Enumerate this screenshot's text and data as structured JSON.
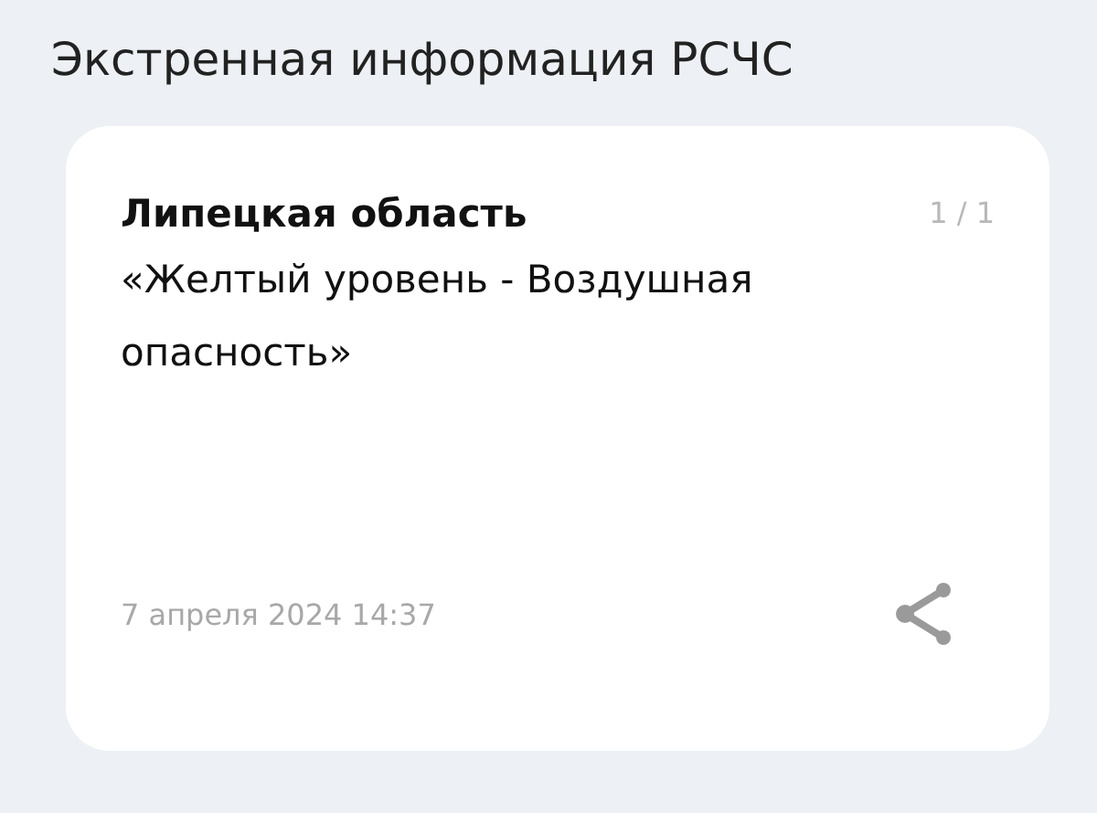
{
  "header": {
    "title": "Экстренная информация РСЧС"
  },
  "alert": {
    "region": "Липецкая область",
    "counter": "1 / 1",
    "message": "«Желтый уровень - Воздушная опасность»",
    "date": "7 апреля 2024 14:37"
  }
}
